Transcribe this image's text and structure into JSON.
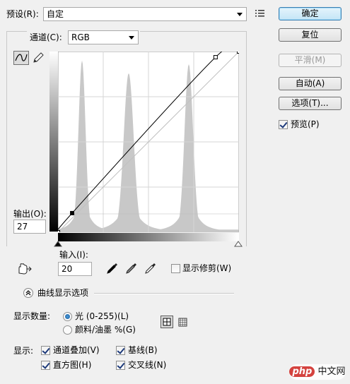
{
  "preset": {
    "label": "预设(R):",
    "value": "自定"
  },
  "channel": {
    "label": "通道(C):",
    "value": "RGB"
  },
  "buttons": {
    "ok": "确定",
    "reset": "复位",
    "smooth": "平滑(M)",
    "auto": "自动(A)",
    "options": "选项(T)...",
    "preview": "预览(P)"
  },
  "preview_checked": true,
  "output": {
    "label": "输出(O):",
    "value": "27"
  },
  "input": {
    "label": "输入(I):",
    "value": "20"
  },
  "show_clipping": {
    "label": "显示修剪(W)",
    "checked": false
  },
  "curve_display": {
    "section_label": "曲线显示选项"
  },
  "display_amount": {
    "label": "显示数量:",
    "light": "光 (0-255)(L)",
    "pigment": "颜料/油墨 %(G)",
    "selected": "light"
  },
  "show": {
    "label": "显示:",
    "channel_overlays": {
      "label": "通道叠加(V)",
      "checked": true
    },
    "baseline": {
      "label": "基线(B)",
      "checked": true
    },
    "histogram": {
      "label": "直方图(H)",
      "checked": true
    },
    "intersection": {
      "label": "交叉线(N)",
      "checked": true
    }
  },
  "icons": [
    "curve-point-icon",
    "pencil-icon",
    "preset-menu-icon",
    "hand-target-icon",
    "black-eyedropper-icon",
    "gray-eyedropper-icon",
    "white-eyedropper-icon",
    "grid-4-icon",
    "grid-10-icon",
    "chevron-up-icon"
  ],
  "curve": {
    "points": [
      [
        0,
        0
      ],
      [
        20,
        27
      ],
      [
        222,
        247
      ],
      [
        255,
        255
      ]
    ]
  },
  "histogram_peaks": [
    {
      "center": 34,
      "height": 0.95,
      "width": 5
    },
    {
      "center": 100,
      "height": 0.88,
      "width": 7
    },
    {
      "center": 185,
      "height": 0.93,
      "width": 6
    }
  ],
  "watermark": {
    "brand": "php",
    "text": "中文网"
  }
}
